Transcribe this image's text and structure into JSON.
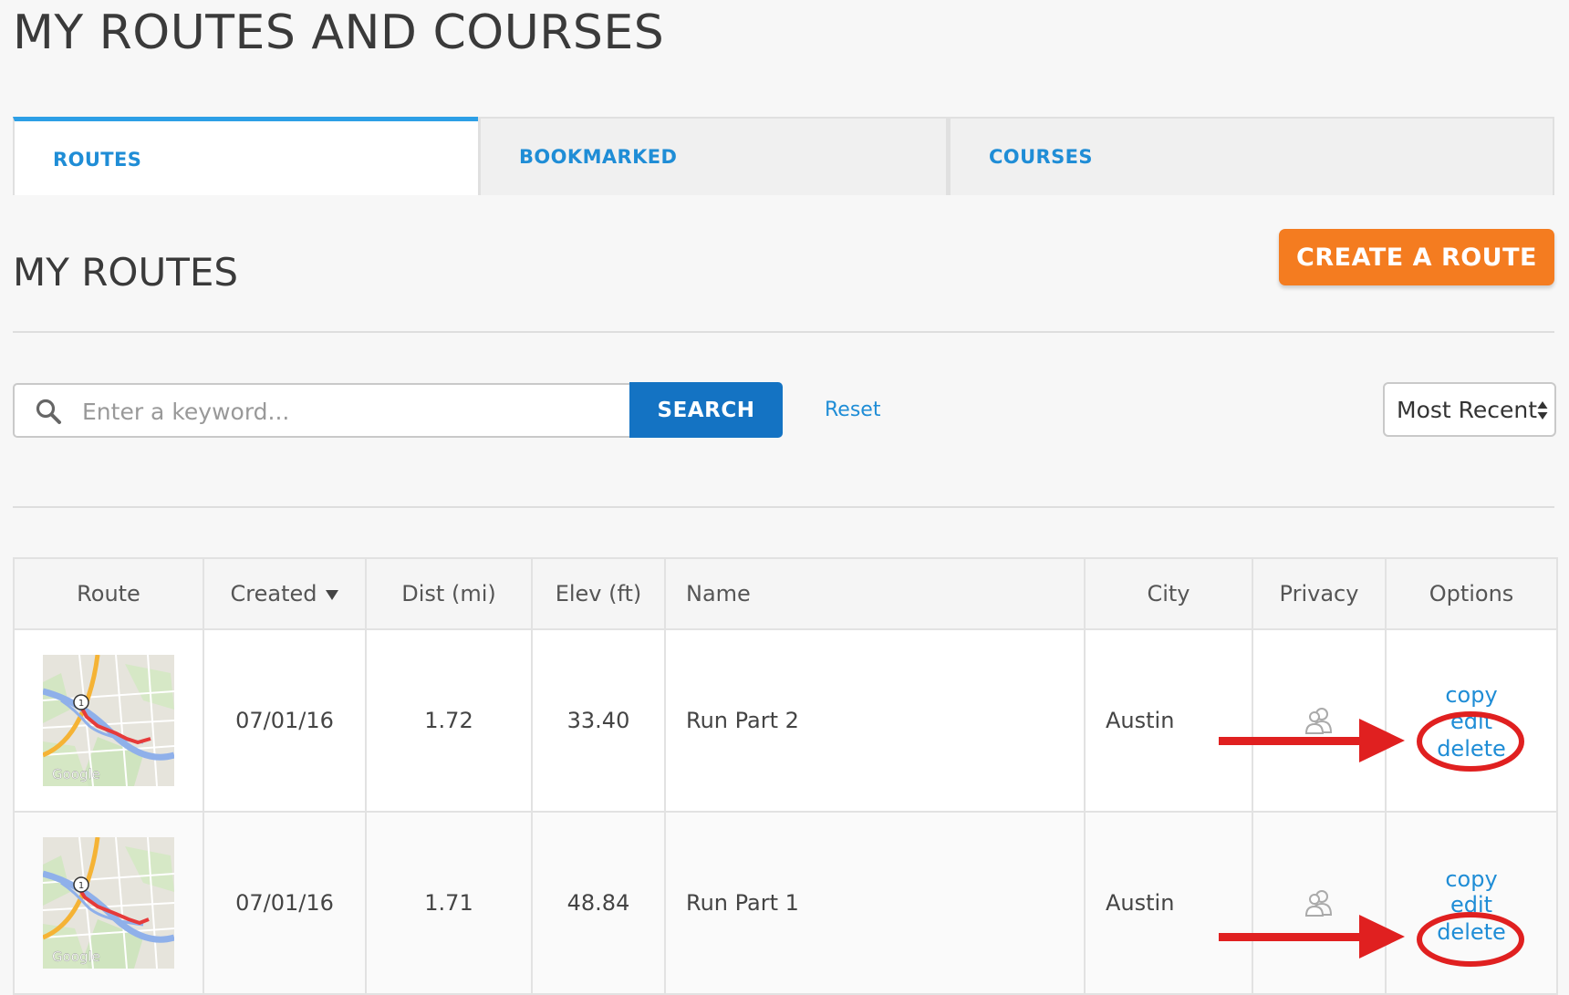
{
  "page": {
    "title": "MY ROUTES AND COURSES",
    "section_title": "MY ROUTES"
  },
  "tabs": [
    {
      "label": "ROUTES",
      "active": true
    },
    {
      "label": "BOOKMARKED",
      "active": false
    },
    {
      "label": "COURSES",
      "active": false
    }
  ],
  "toolbar": {
    "create_label": "CREATE A ROUTE",
    "search_placeholder": "Enter a keyword...",
    "search_value": "",
    "search_label": "SEARCH",
    "reset_label": "Reset",
    "sort_selected": "Most Recent"
  },
  "table": {
    "columns": [
      "Route",
      "Created",
      "Dist (mi)",
      "Elev (ft)",
      "Name",
      "City",
      "Privacy",
      "Options"
    ],
    "rows": [
      {
        "created": "07/01/16",
        "dist": "1.72",
        "elev": "33.40",
        "name": "Run Part 2",
        "city": "Austin",
        "options": {
          "copy": "copy",
          "edit": "edit",
          "delete": "delete"
        },
        "highlighted_option": "edit"
      },
      {
        "created": "07/01/16",
        "dist": "1.71",
        "elev": "48.84",
        "name": "Run Part 1",
        "city": "Austin",
        "options": {
          "copy": "copy",
          "edit": "edit",
          "delete": "delete"
        },
        "highlighted_option": "delete"
      }
    ],
    "thumbnail_credit": "Google",
    "privacy_icon": "friends-icon"
  },
  "colors": {
    "accent": "#1f8dd6",
    "create_button": "#f47c20",
    "search_button": "#1473c3",
    "elevation": "#5fae2e",
    "annotation": "#e02020"
  }
}
